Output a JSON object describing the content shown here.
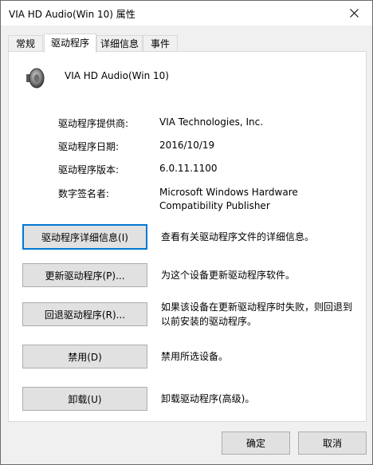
{
  "window": {
    "title": "VIA HD Audio(Win 10) 属性",
    "close_icon": "close-icon"
  },
  "tabs": [
    {
      "label": "常规",
      "active": false
    },
    {
      "label": "驱动程序",
      "active": true
    },
    {
      "label": "详细信息",
      "active": false
    },
    {
      "label": "事件",
      "active": false
    }
  ],
  "device": {
    "icon": "speaker-icon",
    "name": "VIA HD Audio(Win 10)"
  },
  "properties": {
    "provider": {
      "label": "驱动程序提供商:",
      "value": "VIA Technologies, Inc."
    },
    "date": {
      "label": "驱动程序日期:",
      "value": "2016/10/19"
    },
    "version": {
      "label": "驱动程序版本:",
      "value": "6.0.11.1100"
    },
    "signer": {
      "label": "数字签名者:",
      "value_line1": "Microsoft Windows Hardware",
      "value_line2": "Compatibility Publisher"
    }
  },
  "actions": {
    "details": {
      "label": "驱动程序详细信息(I)",
      "description": "查看有关驱动程序文件的详细信息。"
    },
    "update": {
      "label": "更新驱动程序(P)...",
      "description": "为这个设备更新驱动程序软件。"
    },
    "rollback": {
      "label": "回退驱动程序(R)...",
      "description_line1": "如果该设备在更新驱动程序时失败，则回退到",
      "description_line2": "以前安装的驱动程序。"
    },
    "disable": {
      "label": "禁用(D)",
      "description": "禁用所选设备。"
    },
    "uninstall": {
      "label": "卸载(U)",
      "description": "卸载驱动程序(高级)。"
    }
  },
  "footer": {
    "ok_label": "确定",
    "cancel_label": "取消"
  }
}
